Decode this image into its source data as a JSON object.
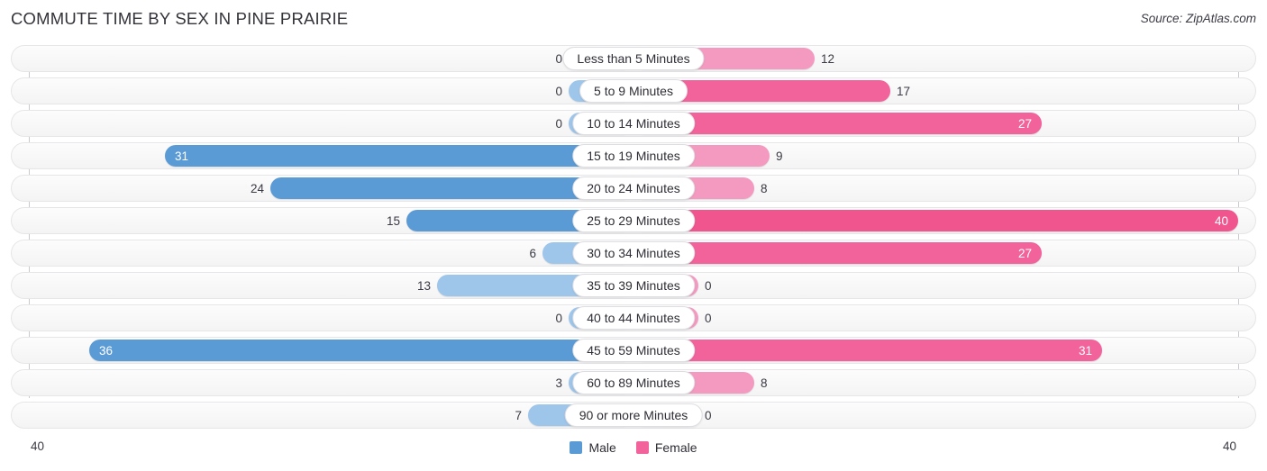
{
  "header": {
    "title": "COMMUTE TIME BY SEX IN PINE PRAIRIE",
    "source": "Source: ZipAtlas.com"
  },
  "legend": {
    "male_label": "Male",
    "female_label": "Female",
    "male_color": "#5b9bd5",
    "female_color": "#f2629b"
  },
  "axis": {
    "left_tick": "40",
    "right_tick": "40",
    "max": 40
  },
  "chart_data": {
    "type": "bar",
    "title": "COMMUTE TIME BY SEX IN PINE PRAIRIE",
    "subtitle": "Source: ZipAtlas.com",
    "orientation": "horizontal-diverging",
    "xlabel": "",
    "ylabel": "",
    "xlim": [
      40,
      40
    ],
    "grid": false,
    "legend_position": "bottom-center",
    "categories": [
      "Less than 5 Minutes",
      "5 to 9 Minutes",
      "10 to 14 Minutes",
      "15 to 19 Minutes",
      "20 to 24 Minutes",
      "25 to 29 Minutes",
      "30 to 34 Minutes",
      "35 to 39 Minutes",
      "40 to 44 Minutes",
      "45 to 59 Minutes",
      "60 to 89 Minutes",
      "90 or more Minutes"
    ],
    "series": [
      {
        "name": "Male",
        "values": [
          0,
          0,
          0,
          31,
          24,
          15,
          6,
          13,
          0,
          36,
          3,
          7
        ]
      },
      {
        "name": "Female",
        "values": [
          12,
          17,
          27,
          9,
          8,
          40,
          27,
          0,
          0,
          31,
          8,
          0
        ]
      }
    ]
  },
  "rows": [
    {
      "label": "Less than 5 Minutes",
      "male": "0",
      "female": "12"
    },
    {
      "label": "5 to 9 Minutes",
      "male": "0",
      "female": "17"
    },
    {
      "label": "10 to 14 Minutes",
      "male": "0",
      "female": "27"
    },
    {
      "label": "15 to 19 Minutes",
      "male": "31",
      "female": "9"
    },
    {
      "label": "20 to 24 Minutes",
      "male": "24",
      "female": "8"
    },
    {
      "label": "25 to 29 Minutes",
      "male": "15",
      "female": "40"
    },
    {
      "label": "30 to 34 Minutes",
      "male": "6",
      "female": "27"
    },
    {
      "label": "35 to 39 Minutes",
      "male": "13",
      "female": "0"
    },
    {
      "label": "40 to 44 Minutes",
      "male": "0",
      "female": "0"
    },
    {
      "label": "45 to 59 Minutes",
      "male": "36",
      "female": "31"
    },
    {
      "label": "60 to 89 Minutes",
      "male": "3",
      "female": "8"
    },
    {
      "label": "90 or more Minutes",
      "male": "7",
      "female": "0"
    }
  ]
}
